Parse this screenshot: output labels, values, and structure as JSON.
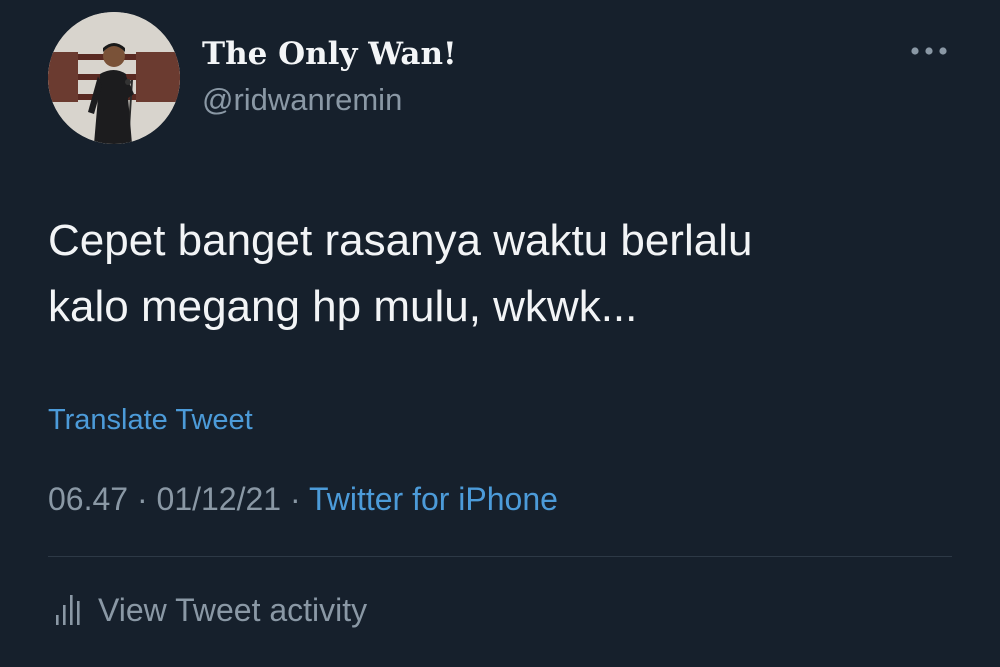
{
  "user": {
    "display_name": "The Only Wan!",
    "handle": "@ridwanremin",
    "avatar_icon": "profile-photo-man-with-microphone"
  },
  "tweet": {
    "text_lines": [
      "Cepet banget rasanya waktu berlalu",
      "kalo megang hp mulu, wkwk..."
    ],
    "translate_label": "Translate Tweet",
    "time": "06.47",
    "date": "01/12/21",
    "separator": "·",
    "source": "Twitter for iPhone"
  },
  "actions": {
    "more_icon": "more-horizontal-icon",
    "activity_label": "View Tweet activity",
    "activity_icon": "bar-chart-icon"
  },
  "colors": {
    "background": "#16202c",
    "text_primary": "#f2f4f6",
    "text_secondary": "#8a98a5",
    "link": "#4c9bd9",
    "divider": "#2d3946"
  }
}
